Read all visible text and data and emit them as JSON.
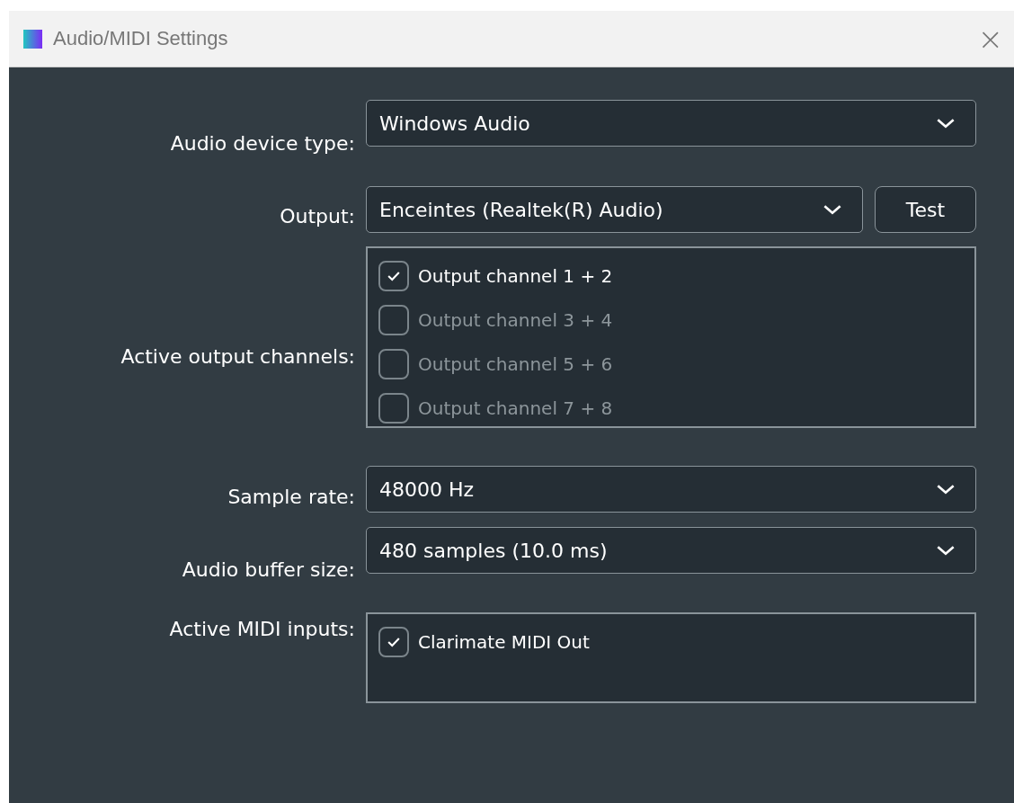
{
  "window": {
    "title": "Audio/MIDI Settings",
    "close": "×"
  },
  "device_type": {
    "label": "Audio device type:",
    "value": "Windows Audio"
  },
  "output": {
    "label": "Output:",
    "value": "Enceintes (Realtek(R) Audio)",
    "button": "Test"
  },
  "active_output_channels": {
    "label": "Active output channels:",
    "items": [
      {
        "label": "Output channel 1 + 2",
        "checked": true
      },
      {
        "label": "Output channel 3 + 4",
        "checked": false
      },
      {
        "label": "Output channel 5 + 6",
        "checked": false
      },
      {
        "label": "Output channel 7 + 8",
        "checked": false
      }
    ]
  },
  "sample_rate": {
    "label": "Sample rate:",
    "value": "48000 Hz"
  },
  "buffer_size": {
    "label": "Audio buffer size:",
    "value": "480 samples (10.0 ms)"
  },
  "midi_inputs": {
    "label": "Active MIDI inputs:",
    "items": [
      {
        "label": "Clarimate MIDI Out",
        "checked": true
      }
    ]
  }
}
